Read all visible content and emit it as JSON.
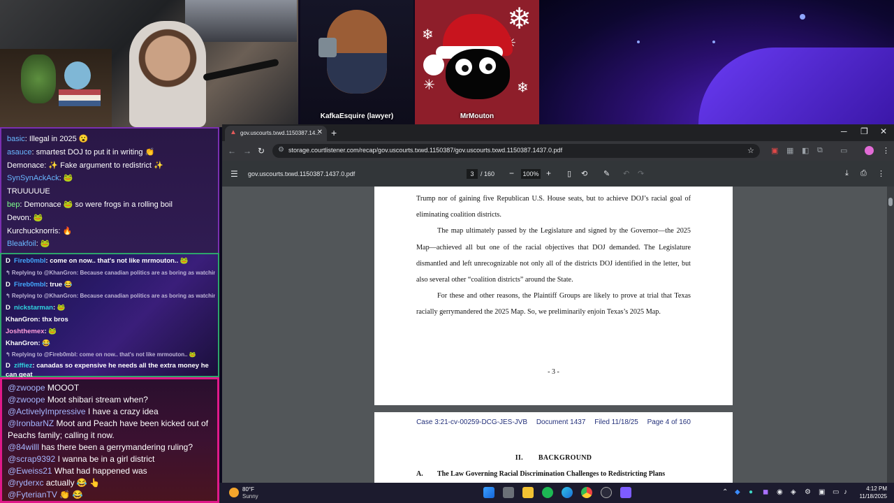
{
  "stream": {
    "tiles": [
      {
        "label": "KafkaEsquire (lawyer)"
      },
      {
        "label": "MrMouton"
      }
    ]
  },
  "chat_top": [
    {
      "user": "basic",
      "text": "Illegal in 2025 😮"
    },
    {
      "user": "asauce",
      "text": "smartest DOJ to put it in writing 👏"
    },
    {
      "user": "Demonace",
      "text": "✨ Fake argument to redistrict ✨"
    },
    {
      "user": "SynSynAckAck",
      "text": "🐸"
    },
    {
      "user": "",
      "text": "TRUUUUUE"
    },
    {
      "user": "bep",
      "text": "Demonace 🐸 so were frogs in a rolling boil"
    },
    {
      "user": "Devon",
      "text": "🐸"
    },
    {
      "user": "Kurchucknorris",
      "text": "🔥"
    },
    {
      "user": "Bleakfoil",
      "text": "🐸"
    }
  ],
  "chat_mid": {
    "line1": {
      "user": "Fireb0mbl",
      "text": "come on now.. that's not like mrmouton.. 🐸"
    },
    "reply1": "↰ Replying to @KhanGron: Because canadian politics are as boring as watchin...",
    "line2": {
      "user": "Fireb0mbl",
      "text": "true 😂"
    },
    "reply2": "↰ Replying to @KhanGron: Because canadian politics are as boring as watchin...",
    "line3": {
      "user": "nickstarman",
      "text": "🐸"
    },
    "line4": {
      "user": "KhanGron",
      "text": "thx bros"
    },
    "line5": {
      "user": "Joshthemex",
      "text": "🐸"
    },
    "line6": {
      "user": "KhanGron",
      "text": "😂"
    },
    "reply3": "↰ Replying to @Fireb0mbl: come on now.. that's not like mrmouton.. 🐸",
    "line7": {
      "user": "ziffiez",
      "text": "canadas so expensive he needs all the extra money he can geat"
    }
  },
  "chat_bottom": [
    {
      "user": "@zwoope",
      "text": "MOOOT"
    },
    {
      "user": "@zwoope",
      "text": "Moot shibari stream when?"
    },
    {
      "user": "@ActivelyImpressive",
      "text": "I have a crazy idea"
    },
    {
      "user": "@IronbarNZ",
      "text": "Moot and Peach have been kicked out of Peachs family; calling it now."
    },
    {
      "user": "@84willl",
      "text": "has there been a gerrymandering ruling?"
    },
    {
      "user": "@scrap9392",
      "text": "I wanna be in a girl district"
    },
    {
      "user": "@Eweiss21",
      "text": "What had happened was"
    },
    {
      "user": "@ryderxc",
      "text": "actually 😂 👆"
    },
    {
      "user": "@FyterianTV",
      "text": "👏 😂"
    }
  ],
  "browser": {
    "tab_title": "gov.uscourts.txwd.1150387.14...",
    "url": "storage.courtlistener.com/recap/gov.uscourts.txwd.1150387/gov.uscourts.txwd.1150387.1437.0.pdf",
    "pdf_filename": "gov.uscourts.txwd.1150387.1437.0.pdf",
    "current_page": "3",
    "total_pages": "/ 160",
    "zoom": "100%"
  },
  "document": {
    "p1": "Trump nor of gaining five Republican U.S. House seats, but to achieve DOJ’s racial goal of eliminating coalition districts.",
    "p2": "The map ultimately passed by the Legislature and signed by the Governor—the 2025 Map—achieved all but one of the racial objectives that DOJ demanded. The Legislature dismantled and left unrecognizable not only all of the districts DOJ identified in the letter, but also several other “coalition districts” around the State.",
    "p3": "For these and other reasons, the Plaintiff Groups are likely to prove at trial that Texas racially gerrymandered the 2025 Map. So, we preliminarily enjoin Texas’s 2025 Map.",
    "page_number": "- 3 -",
    "header": {
      "case": "Case 3:21-cv-00259-DCG-JES-JVB",
      "doc": "Document 1437",
      "filed": "Filed 11/18/25",
      "page": "Page 4 of 160"
    },
    "section_roman": "II.",
    "section_title": "BACKGROUND",
    "subsection_letter": "A.",
    "subsection_title": "The Law Governing Racial Discrimination Challenges to Redistricting Plans"
  },
  "taskbar": {
    "temp": "80°F",
    "condition": "Sunny",
    "time": "4:12 PM",
    "date": "11/18/2025"
  },
  "colors": {
    "chat_border_top": "#7a2fb0",
    "chat_border_mid": "#2ea56b",
    "chat_border_bottom": "#e0198a",
    "pdf_header_text": "#23307a"
  }
}
